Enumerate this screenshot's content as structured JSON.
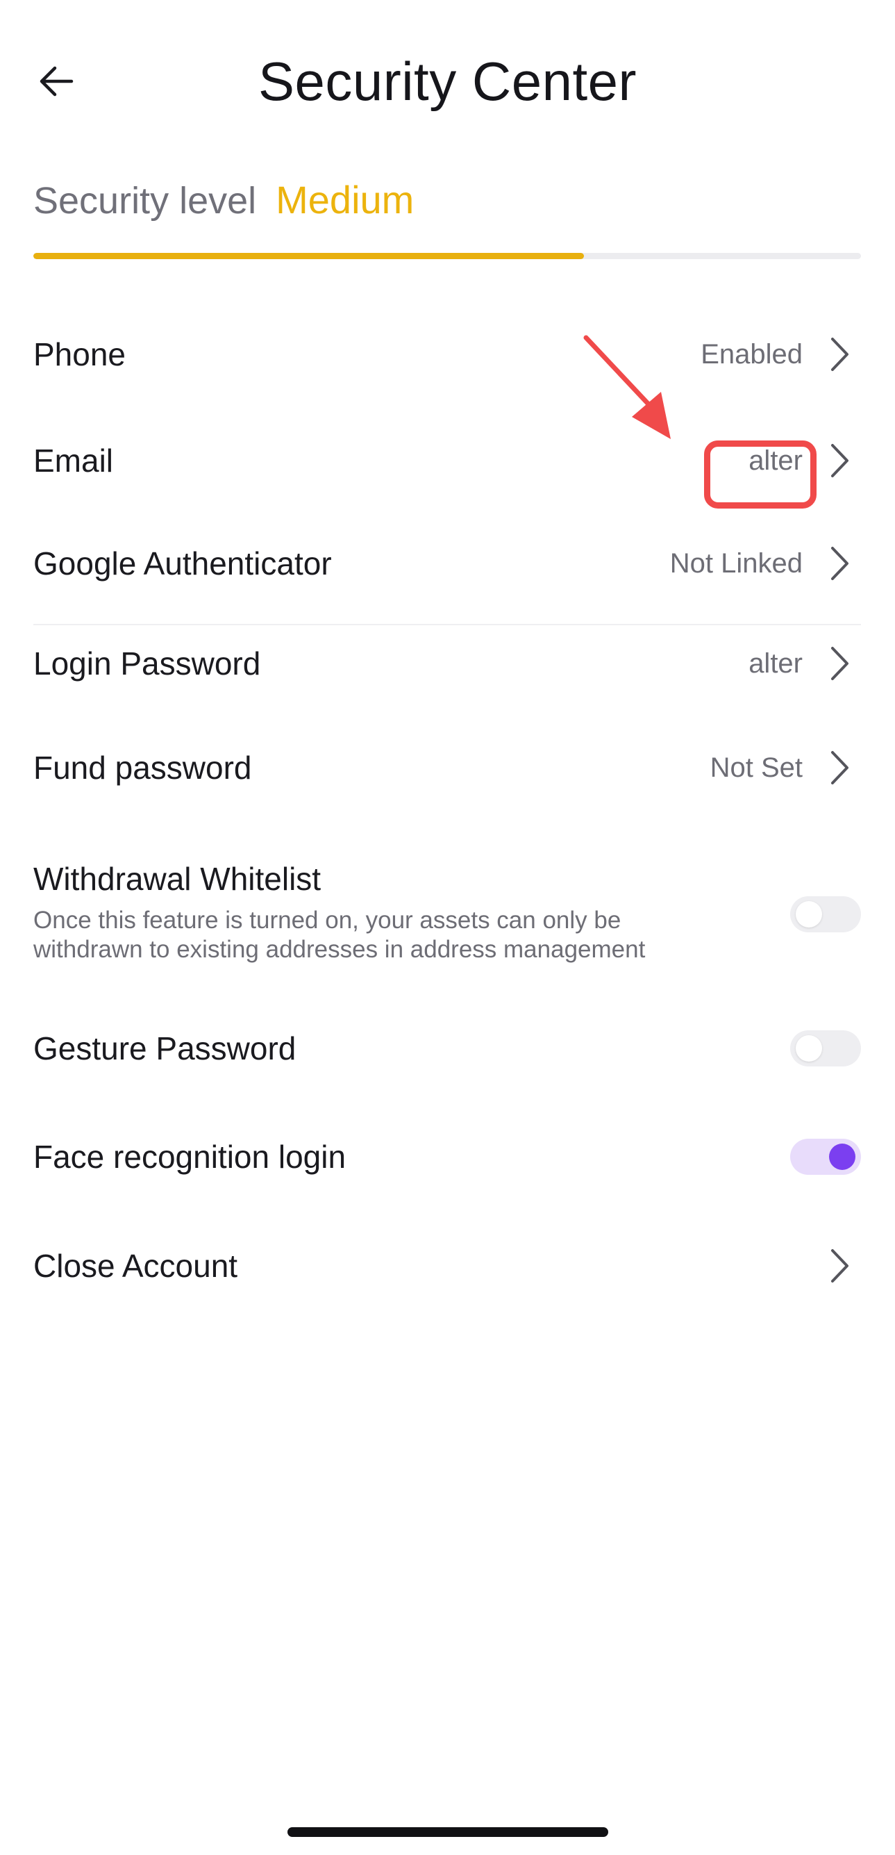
{
  "header": {
    "title": "Security Center",
    "back_icon": "arrow-left-icon"
  },
  "security_level": {
    "label": "Security level",
    "value": "Medium",
    "progress": 0.665,
    "accent_color": "#ecb30d"
  },
  "items": [
    {
      "label": "Phone",
      "value": "Enabled",
      "icon": "chevron-right-icon"
    },
    {
      "label": "Email",
      "value": "alter",
      "icon": "chevron-right-icon"
    },
    {
      "label": "Google Authenticator",
      "value": "Not Linked",
      "icon": "chevron-right-icon"
    },
    {
      "label": "Login Password",
      "value": "alter",
      "icon": "chevron-right-icon"
    },
    {
      "label": "Fund password",
      "value": "Not Set",
      "icon": "chevron-right-icon"
    }
  ],
  "toggles": {
    "withdrawal_whitelist": {
      "label": "Withdrawal Whitelist",
      "description": "Once this feature is turned on, your assets can only be withdrawn to existing addresses in address management",
      "enabled": false
    },
    "gesture_password": {
      "label": "Gesture Password",
      "enabled": false
    },
    "face_recognition": {
      "label": "Face recognition login",
      "enabled": true,
      "accent_color": "#7b3ff0"
    }
  },
  "close_account": {
    "label": "Close Account",
    "icon": "chevron-right-icon"
  },
  "annotation": {
    "highlight_color": "#f04a4a"
  }
}
